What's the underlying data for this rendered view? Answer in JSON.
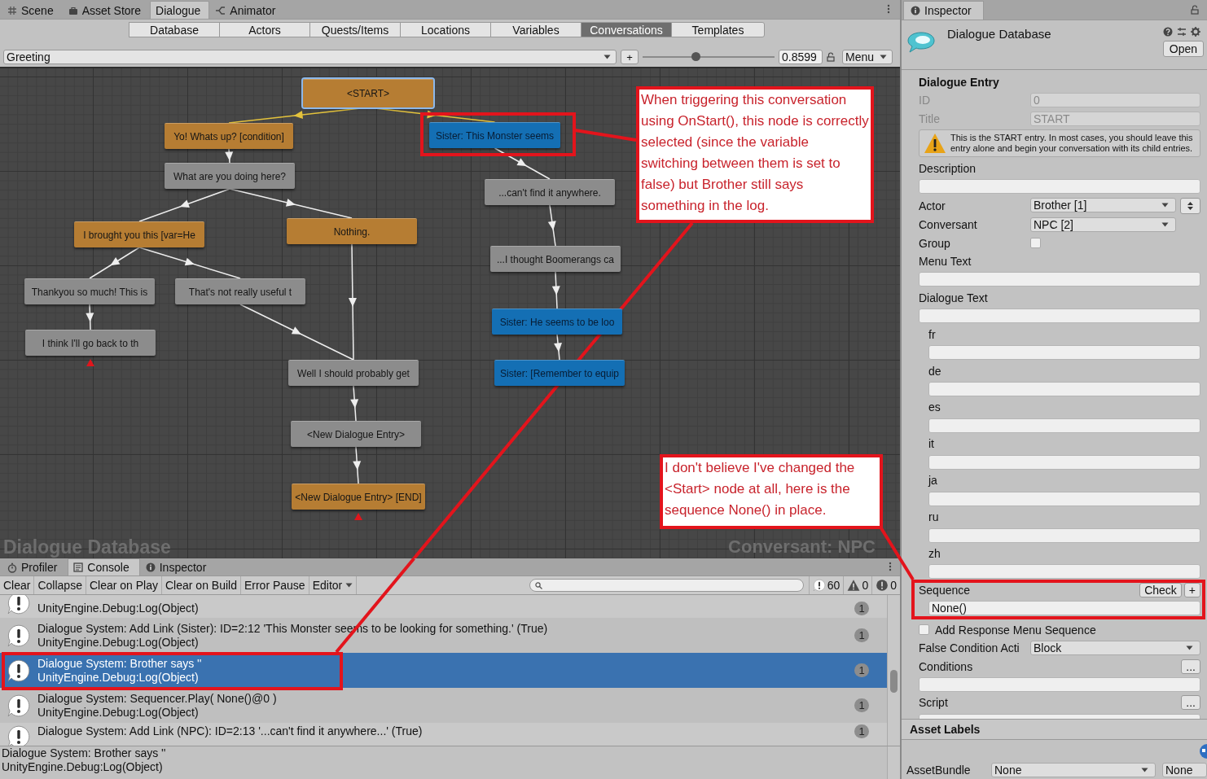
{
  "editor_tabs": [
    {
      "label": "Scene",
      "selected": false
    },
    {
      "label": "Asset Store",
      "selected": false
    },
    {
      "label": "Dialogue",
      "selected": true
    },
    {
      "label": "Animator",
      "selected": false
    }
  ],
  "section_tabs": [
    {
      "label": "Database",
      "selected": false
    },
    {
      "label": "Actors",
      "selected": false
    },
    {
      "label": "Quests/Items",
      "selected": false
    },
    {
      "label": "Locations",
      "selected": false
    },
    {
      "label": "Variables",
      "selected": false
    },
    {
      "label": "Conversations",
      "selected": true
    },
    {
      "label": "Templates",
      "selected": false
    }
  ],
  "conversation_bar": {
    "conversation": "Greeting",
    "add_button": "+",
    "zoom": {
      "level": 0.4
    },
    "zoom_value": "0.8599",
    "menu": "Menu"
  },
  "graph": {
    "nodes": [
      {
        "text": "<START>",
        "color": "#b67d33",
        "selected": true,
        "dead_end": false
      },
      {
        "text": "Yo! Whats up? [condition]",
        "color": "#b67d33",
        "selected": false,
        "dead_end": false
      },
      {
        "text": "Sister: This Monster seems",
        "color": "#146fb4",
        "selected": false,
        "dead_end": false
      },
      {
        "text": "What are you doing here?",
        "color": "#8c8c8c",
        "selected": false,
        "dead_end": false
      },
      {
        "text": "...can't find it anywhere.",
        "color": "#8c8c8c",
        "selected": false,
        "dead_end": false
      },
      {
        "text": "I brought you this [var=He",
        "color": "#b67d33",
        "selected": false,
        "dead_end": false
      },
      {
        "text": "Nothing.",
        "color": "#b67d33",
        "selected": false,
        "dead_end": false
      },
      {
        "text": "...I thought Boomerangs ca",
        "color": "#8c8c8c",
        "selected": false,
        "dead_end": false
      },
      {
        "text": "Thankyou so much! This is",
        "color": "#8c8c8c",
        "selected": false,
        "dead_end": false
      },
      {
        "text": "That's not really useful t",
        "color": "#8c8c8c",
        "selected": false,
        "dead_end": false
      },
      {
        "text": "Sister: He seems to be loo",
        "color": "#146fb4",
        "selected": false,
        "dead_end": false
      },
      {
        "text": "I think I'll go back to th",
        "color": "#8c8c8c",
        "selected": false,
        "dead_end": true
      },
      {
        "text": "Well I should probably get",
        "color": "#8c8c8c",
        "selected": false,
        "dead_end": false
      },
      {
        "text": "Sister: [Remember to equip",
        "color": "#146fb4",
        "selected": false,
        "dead_end": false
      },
      {
        "text": "<New Dialogue Entry>",
        "color": "#8c8c8c",
        "selected": false,
        "dead_end": false
      },
      {
        "text": "<New Dialogue Entry> [END]",
        "color": "#b67d33",
        "selected": false,
        "dead_end": true
      }
    ],
    "database_label": "Dialogue Database",
    "conversant_label": "Conversant: NPC"
  },
  "console": {
    "tabs": [
      {
        "label": "Profiler",
        "selected": false
      },
      {
        "label": "Console",
        "selected": true
      },
      {
        "label": "Inspector",
        "selected": false
      }
    ],
    "toolbar": [
      "Clear",
      "Collapse",
      "Clear on Play",
      "Clear on Build",
      "Error Pause"
    ],
    "editor_menu": "Editor",
    "counts": [
      {
        "kind": "log",
        "count": "60"
      },
      {
        "kind": "warning",
        "count": "0"
      },
      {
        "kind": "error",
        "count": "0"
      }
    ],
    "rows": [
      {
        "lines": [
          "UnityEngine.Debug:Log(Object)"
        ],
        "count": "1",
        "selected": false
      },
      {
        "lines": [
          "Dialogue System: Add Link (Sister): ID=2:12 'This Monster seems to be looking for something.' (True)",
          "UnityEngine.Debug:Log(Object)"
        ],
        "count": "1",
        "selected": false
      },
      {
        "lines": [
          "Dialogue System: Brother says ''",
          "UnityEngine.Debug:Log(Object)"
        ],
        "count": "1",
        "selected": true
      },
      {
        "lines": [
          "Dialogue System: Sequencer.Play( None()@0 )",
          "UnityEngine.Debug:Log(Object)"
        ],
        "count": "1",
        "selected": false
      },
      {
        "lines": [
          "Dialogue System: Add Link (NPC): ID=2:13 '...can't find it anywhere...' (True)"
        ],
        "count": "1",
        "selected": false
      }
    ],
    "detail": [
      "Dialogue System: Brother says ''",
      "UnityEngine.Debug:Log(Object)"
    ]
  },
  "inspector": {
    "tab": "Inspector",
    "title": "Dialogue Database",
    "open_button": "Open",
    "section": "Dialogue Entry",
    "fields": [
      {
        "kind": "readonly",
        "label": "ID",
        "value": "0"
      },
      {
        "kind": "readonly",
        "label": "Title",
        "value": "START"
      },
      {
        "kind": "warning",
        "text": "This is the START entry. In most cases, you should leave this entry alone and begin your conversation with its child entries."
      },
      {
        "kind": "textarea",
        "label": "Description"
      },
      {
        "kind": "dropdown",
        "label": "Actor",
        "value": "Brother [1]",
        "stepper": true
      },
      {
        "kind": "dropdown",
        "label": "Conversant",
        "value": "NPC [2]",
        "stepper": false
      },
      {
        "kind": "checkbox",
        "label": "Group",
        "checked": false
      },
      {
        "kind": "textarea",
        "label": "Menu Text"
      },
      {
        "kind": "textarea",
        "label": "Dialogue Text"
      },
      {
        "kind": "localized",
        "label": "fr"
      },
      {
        "kind": "localized",
        "label": "de"
      },
      {
        "kind": "localized",
        "label": "es"
      },
      {
        "kind": "localized",
        "label": "it"
      },
      {
        "kind": "localized",
        "label": "ja"
      },
      {
        "kind": "localized",
        "label": "ru"
      },
      {
        "kind": "localized",
        "label": "zh"
      },
      {
        "kind": "sequence",
        "label": "Sequence",
        "value": "None()",
        "buttons": [
          "Check",
          "+"
        ]
      },
      {
        "kind": "toggle",
        "label": "Add Response Menu Sequence",
        "checked": false
      },
      {
        "kind": "select",
        "label": "False Condition Acti",
        "value": "Block"
      },
      {
        "kind": "code",
        "label": "Conditions",
        "button": "..."
      },
      {
        "kind": "code",
        "label": "Script",
        "button": "..."
      }
    ],
    "asset_labels": "Asset Labels",
    "asset_bundle": {
      "label": "AssetBundle",
      "value": "None",
      "variant": "None"
    }
  },
  "annotations": [
    {
      "text": "When triggering this conversation using OnStart(), this node is correctly selected (since the variable switching between them is set to false) but Brother still says something in the log."
    },
    {
      "text": "I don't believe I've changed the <Start> node at all, here is the sequence None() in place."
    }
  ]
}
